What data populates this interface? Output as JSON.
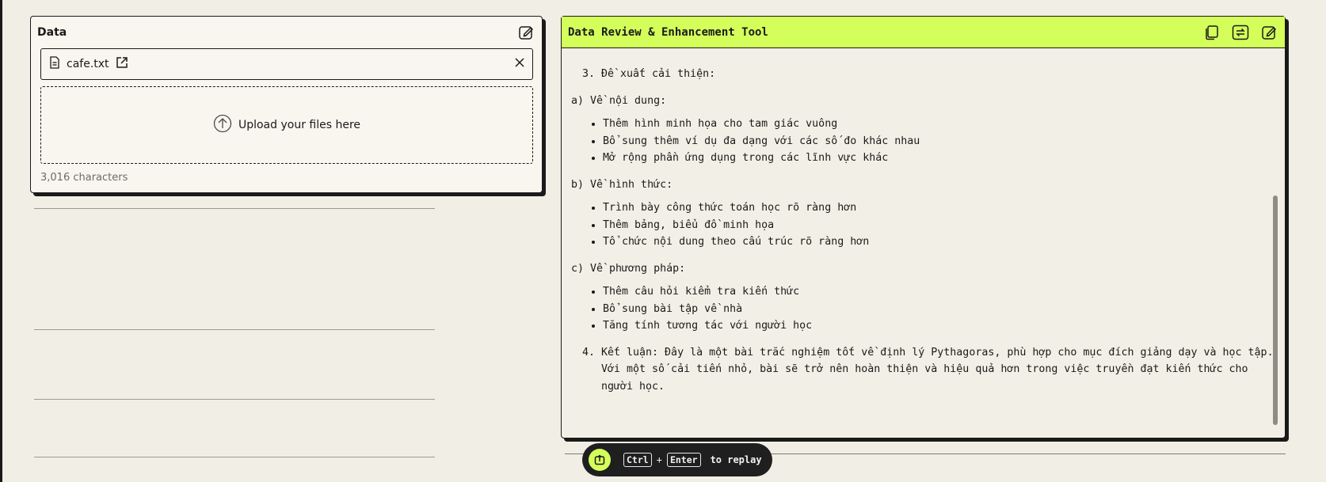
{
  "data_panel": {
    "title": "Data",
    "file_name": "cafe.txt",
    "upload_label": "Upload your files here",
    "char_count": "3,016 characters"
  },
  "tool_panel": {
    "title": "Data Review & Enhancement Tool",
    "content": {
      "item3": "Đề xuất cải thiện:",
      "a_heading": "a) Về nội dung:",
      "a_items": [
        "Thêm hình minh họa cho tam giác vuông",
        "Bổ sung thêm ví dụ đa dạng với các số đo khác nhau",
        "Mở rộng phần ứng dụng trong các lĩnh vực khác"
      ],
      "b_heading": "b) Về hình thức:",
      "b_items": [
        "Trình bày công thức toán học rõ ràng hơn",
        "Thêm bảng, biểu đồ minh họa",
        "Tổ chức nội dung theo cấu trúc rõ ràng hơn"
      ],
      "c_heading": "c) Về phương pháp:",
      "c_items": [
        "Thêm câu hỏi kiểm tra kiến thức",
        "Bổ sung bài tập về nhà",
        "Tăng tính tương tác với người học"
      ],
      "item4": "Kết luận: Đây là một bài trắc nghiệm tốt về định lý Pythagoras, phù hợp cho mục đích giảng dạy và học tập. Với một số cải tiến nhỏ, bài sẽ trở nên hoàn thiện và hiệu quả hơn trong việc truyền đạt kiến thức cho người học."
    }
  },
  "replay": {
    "key1": "Ctrl",
    "plus": "+",
    "key2": "Enter",
    "label": "to replay"
  },
  "icons": {
    "edit": "edit-icon",
    "file": "file-icon",
    "external": "external-link-icon",
    "close": "close-icon",
    "upload": "upload-icon",
    "copy": "copy-icon",
    "swap": "swap-icon",
    "replay": "replay-icon"
  },
  "colors": {
    "accent": "#d4ff5a",
    "background": "#f1efe5",
    "ink": "#1a1a1a"
  }
}
